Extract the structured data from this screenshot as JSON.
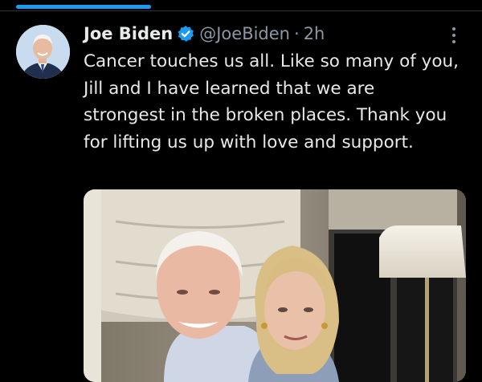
{
  "tweet": {
    "display_name": "Joe Biden",
    "handle": "@JoeBiden",
    "separator": "·",
    "time": "2h",
    "text": "Cancer touches us all. Like so many of you, Jill and I have learned that we are strongest in the broken places. Thank you for lifting us up with love and support."
  },
  "icons": {
    "verified": "verified-badge-icon",
    "more": "more-options-icon"
  },
  "colors": {
    "background": "#000000",
    "text": "#e7e9ea",
    "secondary_text": "#8b98a5",
    "accent": "#1d9bf0"
  }
}
